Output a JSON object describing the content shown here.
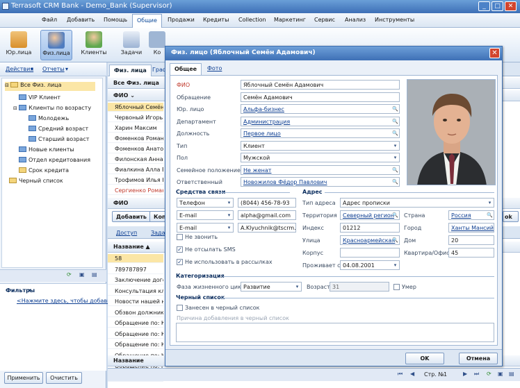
{
  "window": {
    "title": "Terrasoft CRM Bank - Demo_Bank (Supervisor)"
  },
  "menu": {
    "items": [
      "Файл",
      "Добавить",
      "Помощь",
      "Общие",
      "Продажи",
      "Кредиты",
      "Collection",
      "Маркетинг",
      "Сервис",
      "Анализ",
      "Инструменты"
    ],
    "active": "Общие"
  },
  "ribbon": {
    "buttons": [
      "Юр.лица",
      "Физ.лица",
      "Клиенты",
      "Задачи",
      "Ко"
    ],
    "selected": "Физ.лица"
  },
  "leftpanel": {
    "actions": "Действия",
    "reports": "Отчеты",
    "tree": [
      {
        "label": "Все Физ. лица",
        "level": 0
      },
      {
        "label": "VIP Клиент",
        "level": 1
      },
      {
        "label": "Клиенты по возрасту",
        "level": 1
      },
      {
        "label": "Молодежь",
        "level": 2
      },
      {
        "label": "Средний возраст",
        "level": 2
      },
      {
        "label": "Старший возраст",
        "level": 2
      },
      {
        "label": "Новые клиенты",
        "level": 1
      },
      {
        "label": "Отдел кредитования",
        "level": 1
      },
      {
        "label": "Срок кредита",
        "level": 1
      },
      {
        "label": "Черный список",
        "level": 0
      }
    ],
    "filters_title": "Фильтры",
    "filters_link": "<Нажмите здесь, чтобы добавить",
    "apply": "Применить",
    "clear": "Очистить"
  },
  "center": {
    "tab": "Физ. лица",
    "tab2": "Граф",
    "grid_title": "Все Физ. лица",
    "col_fio": "ФИО",
    "rows": [
      "Яблочный Семён А",
      "Червоный Игорь А",
      "Харин Максим",
      "Фоменков Роман И",
      "Фоменков Анатолий",
      "Филонская Анна И",
      "Фиалкина Алла Вас",
      "Трофимов Илья Ник",
      "Сергиенко Роман В"
    ],
    "footer_col": "ФИО",
    "add": "Добавить",
    "copy": "Копи",
    "tab_access": "Доступ",
    "tab_tasks": "Задач",
    "col_name": "Название",
    "rows2": [
      "58",
      "789787897",
      "Заключение догово",
      "Консультация клие",
      "Новости нашей ко",
      "Обзвон должнико",
      "Обращение по: Кр",
      "Обращение по: Кр",
      "Обращение по: Кр",
      "Обращение по: Кр",
      "Обращение по: Кр",
      "Обращение по: Кр"
    ],
    "footer_col2": "Название",
    "page_label": "Стр. №",
    "page_num": "1",
    "ok_tag": "ok"
  },
  "dialog": {
    "title": "Физ. лицо (Яблочный Семён Адамович)",
    "tabs": [
      "Общее",
      "Фото"
    ],
    "fields": [
      {
        "label": "ФИО",
        "value": "Яблочный Семён Адамович",
        "required": true
      },
      {
        "label": "Обращение",
        "value": "Семён Адамович"
      },
      {
        "label": "Юр. лицо",
        "value": "Альфа-бизнес",
        "link": true,
        "icon": "search"
      },
      {
        "label": "Департамент",
        "value": "Администрация",
        "link": true,
        "icon": "search"
      },
      {
        "label": "Должность",
        "value": "Первое лицо",
        "link": true,
        "icon": "search"
      },
      {
        "label": "Тип",
        "value": "Клиент",
        "icon": "dropdown"
      },
      {
        "label": "Пол",
        "value": "Мужской",
        "icon": "dropdown"
      },
      {
        "label": "Семейное положение",
        "value": "Не женат",
        "link": true,
        "icon": "search"
      },
      {
        "label": "Ответственный",
        "value": "Новожилов Фёдор Павлович",
        "link": true,
        "icon": "search"
      }
    ],
    "comm_title": "Средства связи",
    "comms": [
      {
        "type": "Телефон",
        "value": "(8044) 456-78-93"
      },
      {
        "type": "E-mail",
        "value": "alpha@gmail.com"
      },
      {
        "type": "E-mail",
        "value": "A.Klyuchnik@tscrm.cor"
      }
    ],
    "no_call": "Не звонить",
    "no_sms": "Не отсылать SMS",
    "no_mailing": "Не использовать в рассылках",
    "address_title": "Адрес",
    "addr": {
      "type_label": "Тип адреса",
      "type_value": "Адрес прописки",
      "territory_label": "Территория",
      "territory_value": "Северный регион",
      "country_label": "Страна",
      "country_value": "Россия",
      "index_label": "Индекс",
      "index_value": "01212",
      "city_label": "Город",
      "city_value": "Ханты Мансийс",
      "street_label": "Улица",
      "street_value": "Красноармейская",
      "house_label": "Дом",
      "house_value": "20",
      "building_label": "Корпус",
      "building_value": "",
      "flat_label": "Квартира/Офис",
      "flat_value": "45",
      "since_label": "Проживает с",
      "since_value": "04.08.2001"
    },
    "categ_title": "Категоризация",
    "lifecycle_label": "Фаза жизненного цикла",
    "lifecycle_value": "Развитие",
    "age_label": "Возраст",
    "age_value": "31",
    "dead_label": "Умер",
    "blacklist_title": "Черный список",
    "blacklist_check": "Занесен в черный список",
    "blacklist_reason": "Причина добавления в черный список",
    "ok": "OK",
    "cancel": "Отмена"
  }
}
